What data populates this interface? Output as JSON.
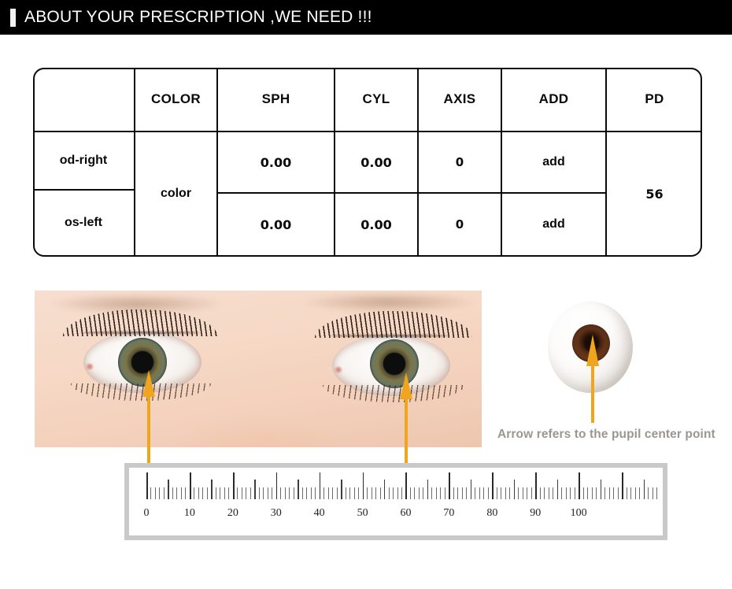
{
  "header": {
    "title": "ABOUT YOUR PRESCRIPTION ,WE NEED !!!",
    "background_color": "#000000",
    "text_color": "#ffffff",
    "accent_color": "#f2f2f2"
  },
  "prescription_table": {
    "columns": [
      "",
      "COLOR",
      "SPH",
      "CYL",
      "AXIS",
      "ADD",
      "PD"
    ],
    "rows": [
      {
        "eye": "od-right",
        "color": "color",
        "sph": "0.00",
        "cyl": "0.00",
        "axis": "0",
        "add": "add",
        "pd": "56"
      },
      {
        "eye": "os-left",
        "color": "color",
        "sph": "0.00",
        "cyl": "0.00",
        "axis": "0",
        "add": "add",
        "pd": "56"
      }
    ],
    "merged_color_value": "color",
    "merged_pd_value": "56",
    "border_color": "#0b0b0b"
  },
  "illustration": {
    "caption": "Arrow refers to the pupil center point",
    "caption_color": "#9b9691",
    "arrow_color": "#f0a51e",
    "photo_alt": "close-up photograph of a pair of human eyes",
    "diagram_alt": "eyeball diagram with brown iris and dark pupil"
  },
  "ruler": {
    "labels": [
      "0",
      "10",
      "20",
      "30",
      "40",
      "50",
      "60",
      "70",
      "80",
      "90",
      "100"
    ],
    "label_values": [
      0,
      10,
      20,
      30,
      40,
      50,
      60,
      70,
      80,
      90,
      100
    ],
    "min": 0,
    "max": 118,
    "major_interval": 10,
    "mid_interval": 5,
    "minor_interval": 1,
    "frame_color": "#c9c9c9",
    "tick_color": "#3a3a3a",
    "left_marker_value": 0,
    "right_marker_value": 56
  }
}
